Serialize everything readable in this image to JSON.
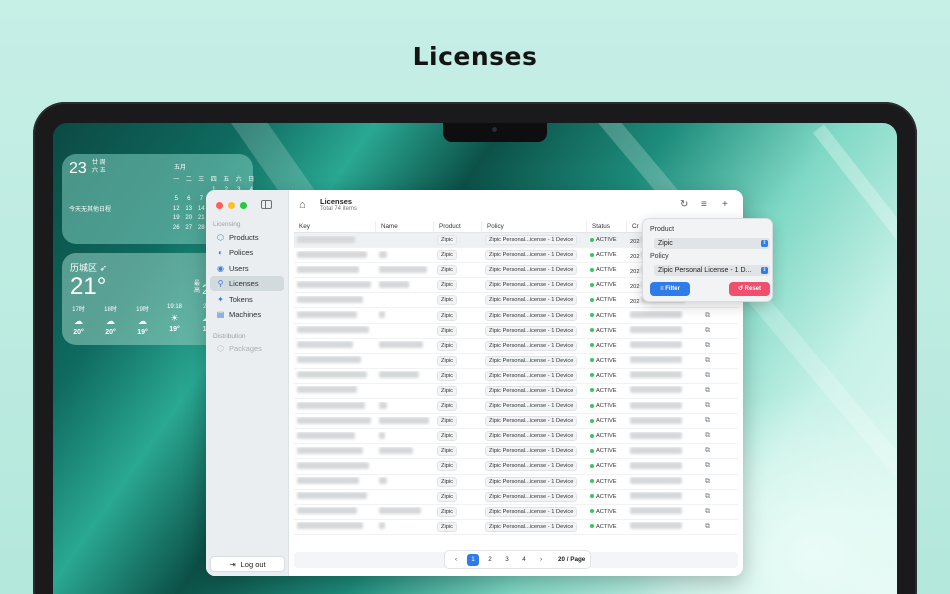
{
  "headline": "Licenses",
  "widgets": {
    "calendar": {
      "day": "23",
      "weekday_lines": [
        "廿",
        "周",
        "六",
        "五"
      ],
      "note": "今天无其他日程",
      "month": "五月",
      "weekdays": [
        "一",
        "二",
        "三",
        "四",
        "五",
        "六",
        "日"
      ],
      "days": [
        "",
        "",
        "",
        "1",
        "2",
        "3",
        "4",
        "5",
        "6",
        "7",
        "8",
        "9",
        "10",
        "11",
        "12",
        "13",
        "14",
        "15",
        "16",
        "17",
        "18",
        "19",
        "20",
        "21",
        "22",
        "23",
        "24",
        "25",
        "26",
        "27",
        "28",
        "29",
        "30",
        "31",
        ""
      ]
    },
    "weather": {
      "city": "历城区 ➶",
      "temp": "21°",
      "side_label": "最高",
      "side_temp": "22",
      "hours": [
        {
          "time": "17时",
          "icon": "☁",
          "temp": "20°"
        },
        {
          "time": "18时",
          "icon": "☁",
          "temp": "20°"
        },
        {
          "time": "19时",
          "icon": "☁",
          "temp": "19°"
        },
        {
          "time": "19:18",
          "icon": "☀",
          "temp": "19°"
        },
        {
          "time": "20",
          "icon": "☁",
          "temp": "19"
        }
      ]
    }
  },
  "sidebar": {
    "section_licensing": "Licensing",
    "items": [
      {
        "label": "Products",
        "icon": "⬡"
      },
      {
        "label": "Polices",
        "icon": "◐"
      },
      {
        "label": "Users",
        "icon": "◉"
      },
      {
        "label": "Licenses",
        "icon": "⚲"
      },
      {
        "label": "Tokens",
        "icon": "✦"
      },
      {
        "label": "Machines",
        "icon": "▤"
      }
    ],
    "section_distribution": "Distribution",
    "dist_items": [
      {
        "label": "Packages",
        "icon": "⬡"
      }
    ],
    "logout_label": "Log out"
  },
  "main": {
    "title": "Licenses",
    "subtitle": "Total 74 items",
    "columns": [
      "Key",
      "Name",
      "Product",
      "Policy",
      "Status",
      "Cr"
    ],
    "row_product": "Zipic",
    "row_policy": "Zipic Personal...icense - 1 Device",
    "row_status": "ACTIVE",
    "row_created_prefix": "202",
    "row_count": 20
  },
  "pagination": {
    "prev": "‹",
    "pages": [
      "1",
      "2",
      "3",
      "4"
    ],
    "current": "1",
    "next": "›",
    "page_size": "20 / Page"
  },
  "filter": {
    "product_label": "Product",
    "product_value": "Zipic",
    "policy_label": "Policy",
    "policy_value": "Zipic Personal License - 1 D...",
    "filter_button": "Filter",
    "reset_button": "Reset"
  },
  "colors": {
    "accent": "#2f7be8",
    "active_status": "#34c759",
    "reset": "#f0506e"
  }
}
